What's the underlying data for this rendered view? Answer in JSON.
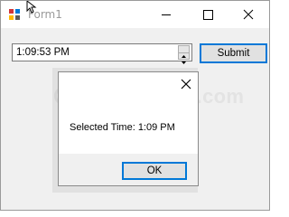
{
  "window": {
    "title": "Form1",
    "icon": "winforms-app-icon",
    "controls": {
      "minimize": "minimize-icon",
      "maximize": "maximize-icon",
      "close": "close-icon"
    }
  },
  "form": {
    "time_value": "1:09:53 PM",
    "spinner": "up-down-spinner-icon",
    "submit_label": "Submit"
  },
  "watermark": {
    "text": "aspsnippets.com"
  },
  "dialog": {
    "message": "Selected Time: 1:09 PM",
    "ok_label": "OK",
    "close_icon": "close-icon"
  },
  "colors": {
    "accent": "#0078d7",
    "background": "#f0f0f0"
  }
}
